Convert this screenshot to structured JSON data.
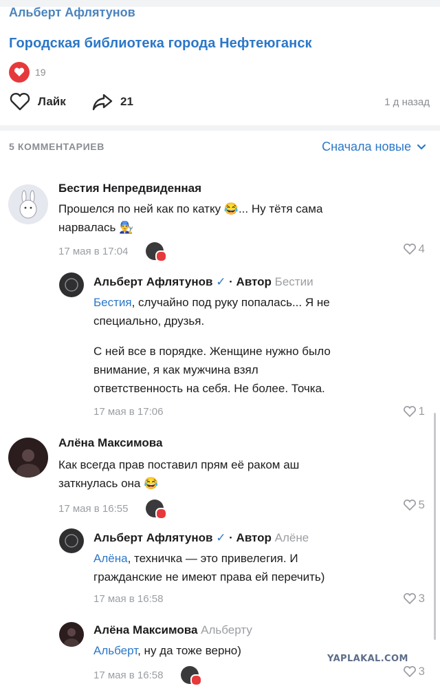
{
  "post": {
    "author_top": "Альберт Афлятунов",
    "group_link": "Городская библиотека города Нефтеюганск",
    "reactions_count": "19",
    "like_label": "Лайк",
    "shares_count": "21",
    "time_ago": "1 д назад"
  },
  "comments_header": {
    "count_label": "5 КОММЕНТАРИЕВ",
    "sort_label": "Сначала новые"
  },
  "comments": [
    {
      "name": "Бестия Непредвиденная",
      "text_lines": [
        "Прошелся по ней как по катку 😂... Ну тётя сама",
        "нарвалась 👨‍🔧"
      ],
      "time": "17 мая в 17:04",
      "likes": "4"
    },
    {
      "name": "Альберт Афлятунов",
      "verified": "✓",
      "role": "· Автор",
      "reply_to": "Бестии",
      "mention": "Бестия",
      "text_lines": [
        ", случайно под руку попалась... Я не",
        "специально, друзья."
      ],
      "para2_lines": [
        "С ней все в порядке. Женщине нужно было",
        "внимание, я как мужчина взял",
        "ответственность на себя. Не более. Точка."
      ],
      "time": "17 мая в 17:06",
      "likes": "1"
    },
    {
      "name": "Алёна Максимова",
      "text_lines": [
        "Как всегда прав поставил прям её раком аш",
        "заткнулась она 😂"
      ],
      "time": "17 мая в 16:55",
      "likes": "5"
    },
    {
      "name": "Альберт Афлятунов",
      "verified": "✓",
      "role": "· Автор",
      "reply_to": "Алёне",
      "mention": "Алёна",
      "text_lines": [
        ", техничка — это привелегия. И",
        "гражданские не имеют права ей перечить)"
      ],
      "time": "17 мая в 16:58",
      "likes": "3"
    },
    {
      "name": "Алёна Максимова",
      "reply_to": "Альберту",
      "mention": "Альберт",
      "text_lines": [
        ", ну да тоже верно)"
      ],
      "time": "17 мая в 16:58",
      "likes": "3"
    }
  ],
  "watermark": "YAPLAKAL.COM",
  "colors": {
    "accent": "#2b77c8",
    "heart": "#e6393b",
    "muted": "#9b9ea3"
  }
}
